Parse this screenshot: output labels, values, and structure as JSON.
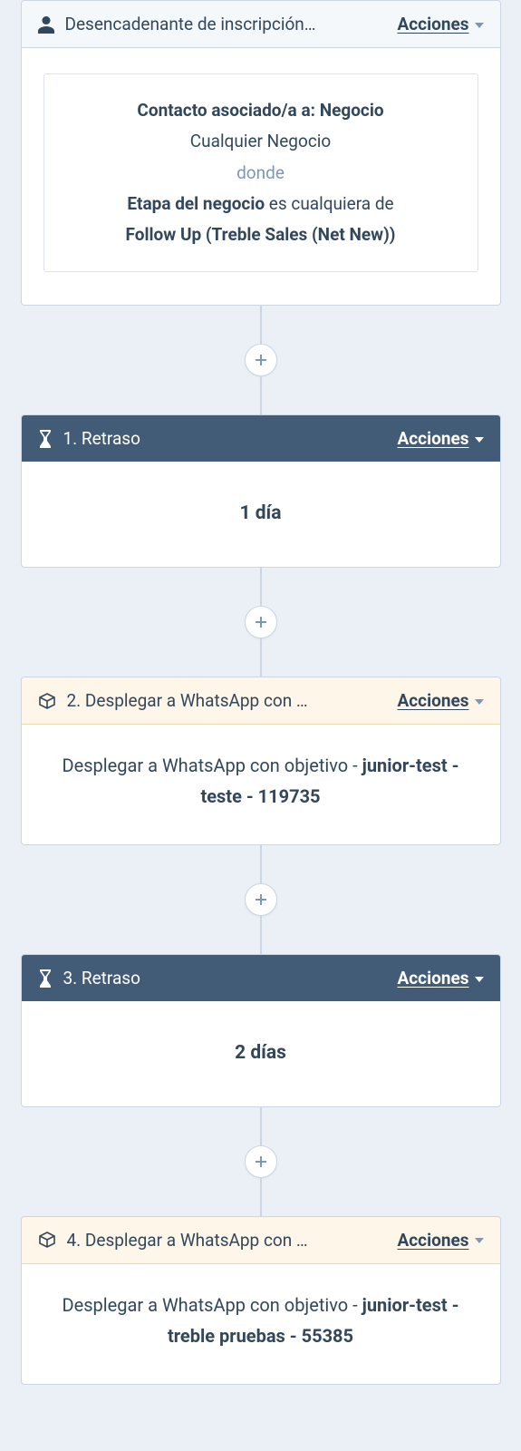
{
  "actions_label": "Acciones",
  "trigger": {
    "title": "Desencadenante de inscripción…",
    "box": {
      "line1_bold": "Contacto asociado/a a: Negocio",
      "line2": "Cualquier Negocio",
      "line3_muted": "donde",
      "line4_pre_bold": "Etapa del negocio",
      "line4_rest": " es cualquiera de",
      "line5_bold": "Follow Up (Treble Sales (Net New))"
    }
  },
  "steps": [
    {
      "kind": "dark",
      "icon": "hourglass",
      "title": "1. Retraso",
      "body_simple": "1 día"
    },
    {
      "kind": "cream",
      "icon": "cube",
      "title": "2. Desplegar a WhatsApp con …",
      "body_prefix": "Desplegar a WhatsApp con objetivo - ",
      "body_bold": "junior-test - teste - 119735"
    },
    {
      "kind": "dark",
      "icon": "hourglass",
      "title": "3. Retraso",
      "body_simple": "2 días"
    },
    {
      "kind": "cream",
      "icon": "cube",
      "title": "4. Desplegar a WhatsApp con …",
      "body_prefix": "Desplegar a WhatsApp con objetivo - ",
      "body_bold": "junior-test - treble pruebas - 55385"
    }
  ]
}
